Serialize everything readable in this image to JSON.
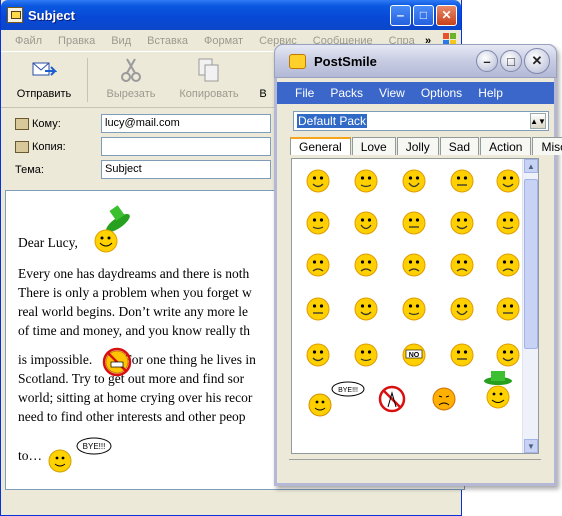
{
  "mail": {
    "title": "Subject",
    "menu": [
      "Файл",
      "Правка",
      "Вид",
      "Вставка",
      "Формат",
      "Сервис",
      "Сообщение",
      "Спра"
    ],
    "menu_more": "»",
    "toolbar": {
      "send": "Отправить",
      "cut": "Вырезать",
      "copy": "Копировать",
      "more": "В"
    },
    "to_label": "Кому:",
    "to_value": "lucy@mail.com",
    "cc_label": "Копия:",
    "cc_value": "",
    "subject_label": "Тема:",
    "subject_value": "Subject",
    "body": {
      "greeting": "Dear Lucy,",
      "lines1": [
        "Every one has daydreams and there is noth",
        "There is only a problem when you forget w",
        "real world begins. Don’t write any more le",
        "of time and money, and you know really th"
      ],
      "line2a": "is impossible.",
      "line2b": "For one thing he lives in",
      "lines3": [
        "Scotland. Try to get out more and find sor",
        "world; sitting at home crying over his recor",
        "need to find other interests and other peop"
      ],
      "closing": "to…",
      "bye_text": "BYE!!!"
    }
  },
  "postsmile": {
    "title": "PostSmile",
    "menu": [
      "File",
      "Packs",
      "View",
      "Options",
      "Help"
    ],
    "pack_selected": "Default Pack",
    "tabs": [
      "General",
      "Love",
      "Jolly",
      "Sad",
      "Action",
      "Misc"
    ],
    "selected_tab": "General",
    "bye_text": "BYE!!!",
    "no_text": "NO"
  }
}
